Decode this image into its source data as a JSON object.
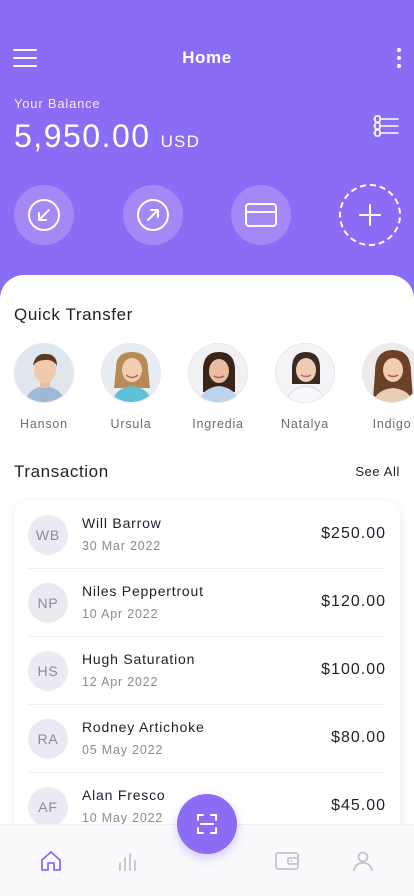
{
  "header": {
    "title": "Home"
  },
  "balance": {
    "label": "Your Balance",
    "amount": "5,950.00",
    "currency": "USD"
  },
  "actions": [
    {
      "name": "receive",
      "icon": "arrow-down-left-circle-icon"
    },
    {
      "name": "send",
      "icon": "arrow-up-right-circle-icon"
    },
    {
      "name": "card",
      "icon": "credit-card-icon"
    },
    {
      "name": "add",
      "icon": "plus-icon"
    }
  ],
  "quick_transfer": {
    "title": "Quick Transfer",
    "contacts": [
      {
        "name": "Hanson"
      },
      {
        "name": "Ursula"
      },
      {
        "name": "Ingredia"
      },
      {
        "name": "Natalya"
      },
      {
        "name": "Indigo"
      }
    ]
  },
  "transactions": {
    "title": "Transaction",
    "see_all": "See All",
    "items": [
      {
        "initials": "WB",
        "name": "Will Barrow",
        "date": "30 Mar 2022",
        "amount": "$250.00"
      },
      {
        "initials": "NP",
        "name": "Niles Peppertrout",
        "date": "10 Apr 2022",
        "amount": "$120.00"
      },
      {
        "initials": "HS",
        "name": "Hugh Saturation",
        "date": "12 Apr 2022",
        "amount": "$100.00"
      },
      {
        "initials": "RA",
        "name": "Rodney Artichoke",
        "date": "05 May 2022",
        "amount": "$80.00"
      },
      {
        "initials": "AF",
        "name": "Alan Fresco",
        "date": "10 May 2022",
        "amount": "$45.00"
      }
    ]
  },
  "bottom_nav": {
    "items": [
      "home-icon",
      "stats-icon",
      "scan-icon",
      "wallet-icon",
      "profile-icon"
    ],
    "active": "home-icon"
  },
  "colors": {
    "accent": "#8b6cf4",
    "text": "#1f1f2e",
    "muted": "#8a8a99"
  }
}
